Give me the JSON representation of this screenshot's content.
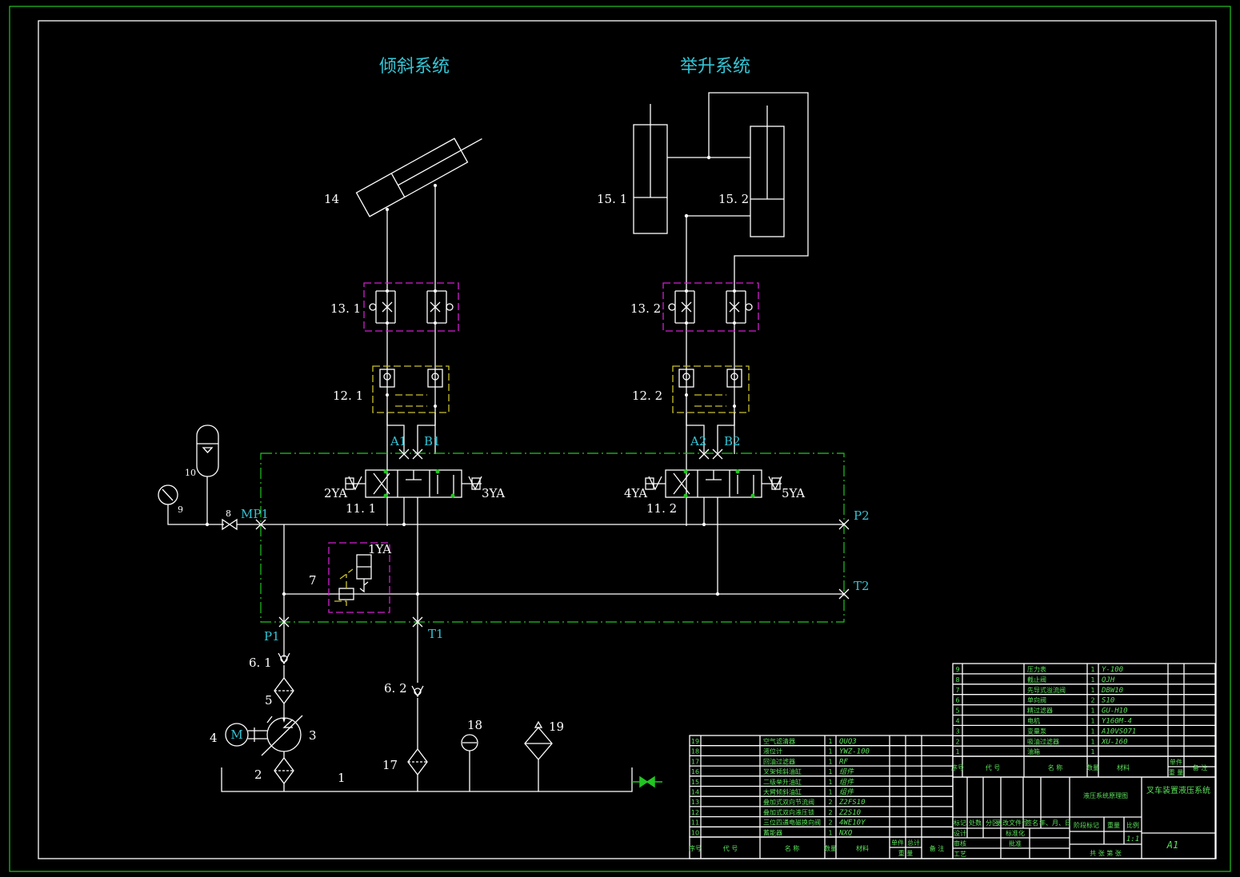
{
  "titles": {
    "tilt": "倾斜系统",
    "lift": "举升系统"
  },
  "labels": {
    "c14": "14",
    "c15_1": "15. 1",
    "c15_2": "15. 2",
    "c13_1": "13. 1",
    "c13_2": "13. 2",
    "c12_1": "12. 1",
    "c12_2": "12. 2",
    "A1": "A1",
    "B1": "B1",
    "A2": "A2",
    "B2": "B2",
    "ya2": "2YA",
    "ya3": "3YA",
    "ya4": "4YA",
    "ya5": "5YA",
    "ya1": "1YA",
    "c11_1": "11. 1",
    "c11_2": "11. 2",
    "MP1": "MP1",
    "P2": "P2",
    "T2": "T2",
    "P1": "P1",
    "T1": "T1",
    "c10": "10",
    "c9": "9",
    "c8": "8",
    "c7": "7",
    "c6_1": "6. 1",
    "c6_2": "6. 2",
    "c5": "5",
    "c4": "4",
    "c3": "3",
    "c2": "2",
    "c1": "1",
    "c17": "17",
    "c18": "18",
    "c19": "19",
    "motor": "M"
  },
  "bom_right": [
    {
      "no": "9",
      "name": "压力表",
      "qty": "1",
      "code": "Y-100"
    },
    {
      "no": "8",
      "name": "截止阀",
      "qty": "1",
      "code": "QJH"
    },
    {
      "no": "7",
      "name": "先导式溢流阀",
      "qty": "1",
      "code": "DBW10"
    },
    {
      "no": "6",
      "name": "单向阀",
      "qty": "2",
      "code": "S10"
    },
    {
      "no": "5",
      "name": "精过滤器",
      "qty": "1",
      "code": "GU-H10"
    },
    {
      "no": "4",
      "name": "电机",
      "qty": "1",
      "code": "Y160M-4"
    },
    {
      "no": "3",
      "name": "变量泵",
      "qty": "1",
      "code": "A10VSO71"
    },
    {
      "no": "2",
      "name": "吸油过滤器",
      "qty": "1",
      "code": "XU-160"
    },
    {
      "no": "1",
      "name": "油箱",
      "qty": "1",
      "code": ""
    }
  ],
  "bom_left": [
    {
      "no": "19",
      "name": "空气滤清器",
      "qty": "1",
      "code": "QUQ3"
    },
    {
      "no": "18",
      "name": "液位计",
      "qty": "1",
      "code": "YWZ-100"
    },
    {
      "no": "17",
      "name": "回油过滤器",
      "qty": "1",
      "code": "RF"
    },
    {
      "no": "16",
      "name": "叉架倾斜油缸",
      "qty": "1",
      "code": "组件"
    },
    {
      "no": "15",
      "name": "二级举升油缸",
      "qty": "1",
      "code": "组件"
    },
    {
      "no": "14",
      "name": "大臂倾斜油缸",
      "qty": "1",
      "code": "组件"
    },
    {
      "no": "13",
      "name": "叠加式双向节流阀",
      "qty": "2",
      "code": "Z2FS10"
    },
    {
      "no": "12",
      "name": "叠加式双向液压锁",
      "qty": "2",
      "code": "Z2S10"
    },
    {
      "no": "11",
      "name": "三位四通电磁换向阀",
      "qty": "2",
      "code": "4WE10Y"
    },
    {
      "no": "10",
      "name": "蓄能器",
      "qty": "1",
      "code": "NXQ"
    }
  ],
  "bom_header": {
    "no": "序号",
    "code": "代 号",
    "name": "名 称",
    "qty": "数量",
    "material": "材料",
    "unit": "单件",
    "total": "总计",
    "weight": "重 量",
    "remark": "备 注"
  },
  "titleblock": {
    "drawing": "液压系统原理图",
    "product": "叉车装置液压系统",
    "mark": "标记",
    "count": "处数",
    "zone": "分区",
    "docno": "更改文件号",
    "sign": "签名",
    "date": "年、月、日",
    "design": "设计",
    "std": "标准化",
    "stage": "阶段标记",
    "wt": "重量",
    "scale_lbl": "比例",
    "check": "审核",
    "proc": "工艺",
    "approve": "批准",
    "sheets": "共  张 第  张",
    "scale": "1:1",
    "size": "A1"
  }
}
